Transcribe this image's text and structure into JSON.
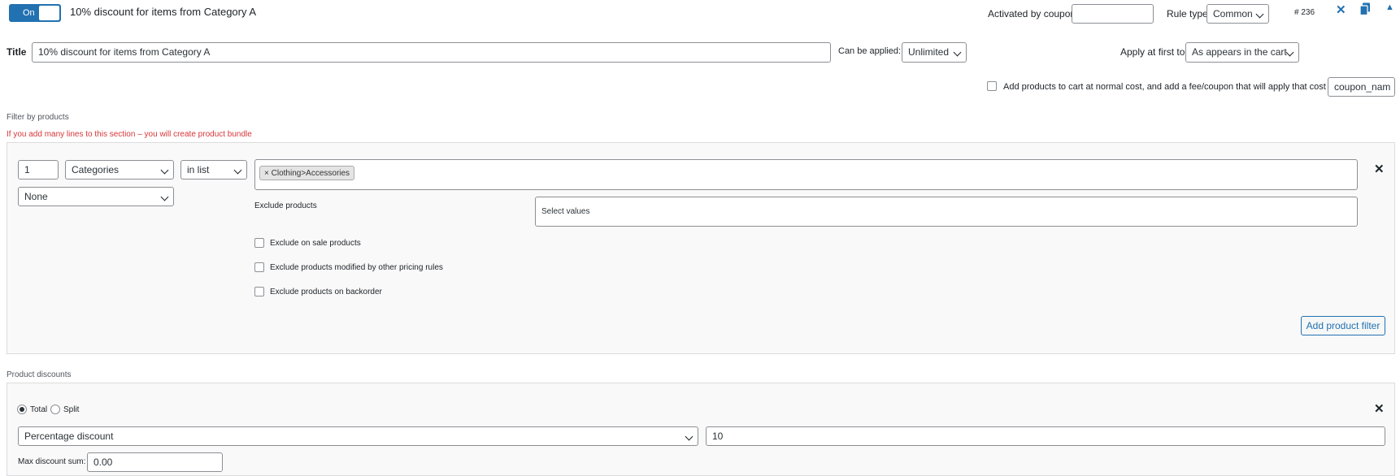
{
  "header": {
    "toggle_label": "On",
    "rule_name": "10% discount for items from Category A",
    "activated_by_coupon_label": "Activated by coupon",
    "activated_by_coupon_value": "",
    "rule_type_label": "Rule type",
    "rule_type_value": "Common",
    "rule_id": "# 236",
    "accent_color": "#2271b1"
  },
  "title_row": {
    "title_label": "Title",
    "title_value": "10% discount for items from Category A",
    "can_be_applied_label": "Can be applied:",
    "can_be_applied_value": "Unlimited",
    "apply_first_label": "Apply at first to:",
    "apply_first_value": "As appears in the cart"
  },
  "add_products_row": {
    "label": "Add products to cart at normal cost, and add a fee/coupon that will apply that cost",
    "coupon_value": "coupon_nam"
  },
  "filter_section": {
    "heading": "Filter by products",
    "warning": "If you add many lines to this section – you will create product bundle",
    "warning_color": "#d63638",
    "qty_value": "1",
    "type_value": "Categories",
    "method_value": "in list",
    "selected_tag": "Clothing>Accessories",
    "tag_remove": "×",
    "attribute_value": "None",
    "exclude_label": "Exclude products",
    "exclude_placeholder": "Select values",
    "checkboxes": [
      "Exclude on sale products",
      "Exclude products modified by other pricing rules",
      "Exclude products on backorder"
    ],
    "add_filter_button": "Add product filter"
  },
  "discount_section": {
    "heading": "Product discounts",
    "radio_total": "Total",
    "radio_split": "Split",
    "discount_type_value": "Percentage discount",
    "discount_amount_value": "10",
    "max_discount_label": "Max discount sum:",
    "max_discount_value": "0.00"
  },
  "icons": {
    "close": "✕",
    "remove": "✕",
    "copy": "copy-icon",
    "collapse": "▲"
  }
}
